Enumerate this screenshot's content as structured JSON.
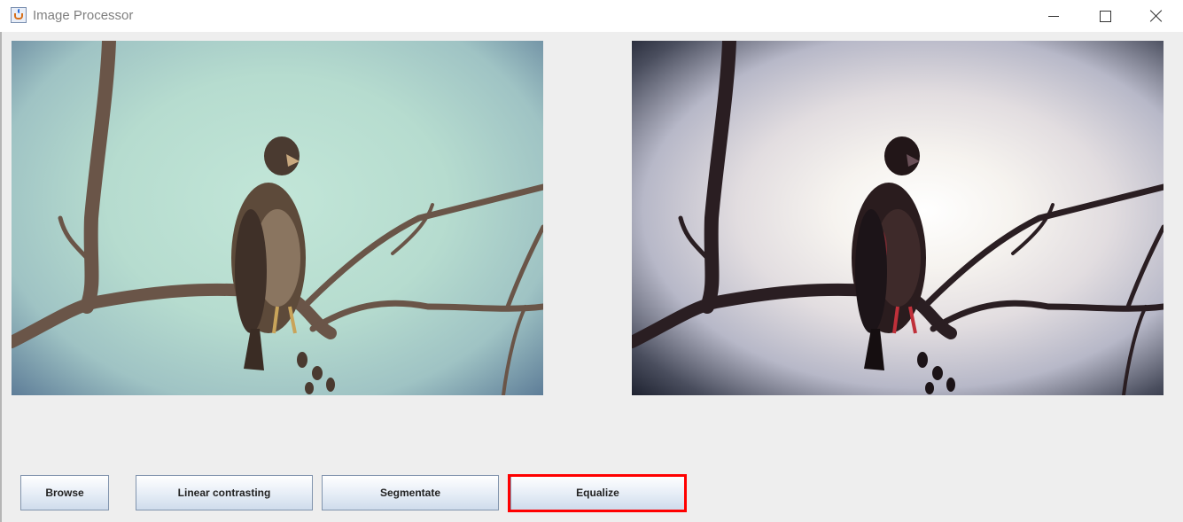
{
  "window": {
    "title": "Image Processor",
    "controls": [
      "minimize",
      "maximize",
      "close"
    ]
  },
  "images": {
    "original": {
      "icon": "bird-on-branch-photo"
    },
    "processed": {
      "icon": "bird-on-branch-photo-equalized"
    }
  },
  "buttons": {
    "browse": "Browse",
    "linear": "Linear contrasting",
    "segmentate": "Segmentate",
    "equalize": "Equalize"
  },
  "highlight": {
    "target": "Equalize",
    "color": "#ff0000"
  }
}
